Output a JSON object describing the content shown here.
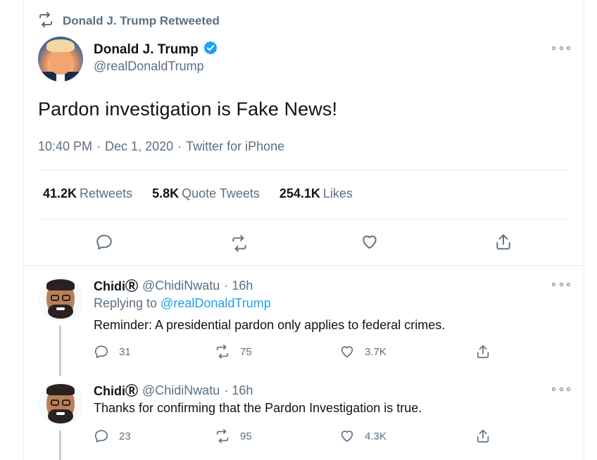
{
  "retweet_banner": {
    "text": "Donald J. Trump Retweeted",
    "icon": "retweet-icon"
  },
  "tweet": {
    "author_name": "Donald J. Trump",
    "author_handle": "@realDonaldTrump",
    "verified": true,
    "text": "Pardon investigation is Fake News!",
    "time": "10:40 PM",
    "date": "Dec 1, 2020",
    "source": "Twitter for iPhone",
    "separator": "·",
    "stats": {
      "retweets_count": "41.2K",
      "retweets_label": "Retweets",
      "quotes_count": "5.8K",
      "quotes_label": "Quote Tweets",
      "likes_count": "254.1K",
      "likes_label": "Likes"
    }
  },
  "replies": [
    {
      "name": "ChidiⓇ",
      "handle": "@ChidiNwatu",
      "time": "· 16h",
      "replying_prefix": "Replying to",
      "replying_to": "@realDonaldTrump",
      "text": "Reminder: A presidential pardon only applies to federal crimes.",
      "reply_count": "31",
      "retweet_count": "75",
      "like_count": "3.7K"
    },
    {
      "name": "ChidiⓇ",
      "handle": "@ChidiNwatu",
      "time": "· 16h",
      "text": "Thanks for confirming that the Pardon Investigation is true.",
      "reply_count": "23",
      "retweet_count": "95",
      "like_count": "4.3K"
    }
  ],
  "colors": {
    "text_primary": "#0f1419",
    "text_secondary": "#5b7083",
    "link": "#1da1f2",
    "divider": "#ebeef0"
  }
}
